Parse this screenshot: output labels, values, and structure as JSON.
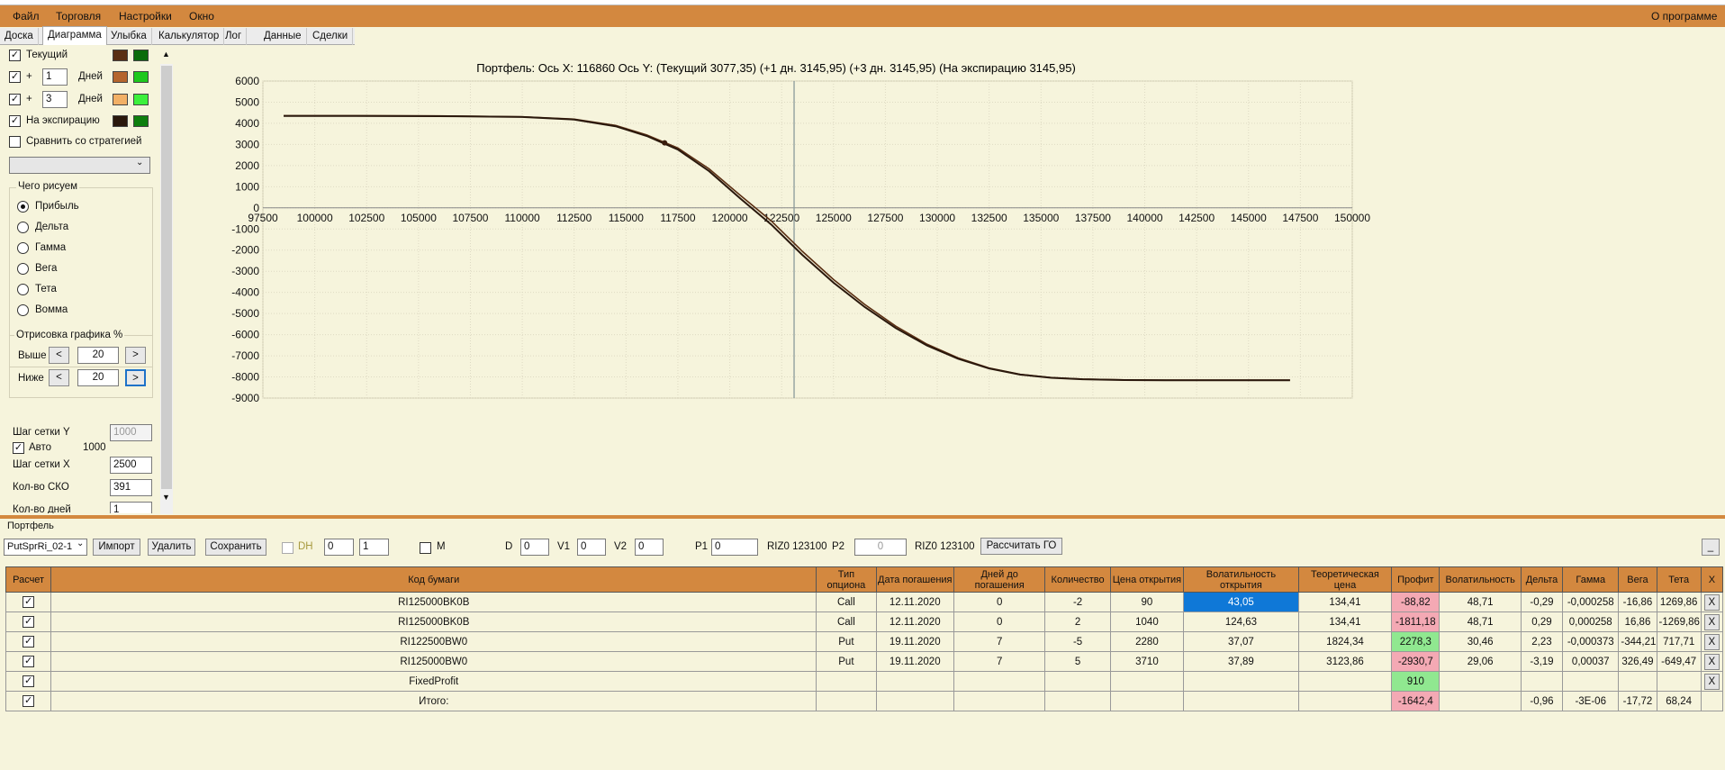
{
  "menu": {
    "file": "Файл",
    "trade": "Торговля",
    "settings": "Настройки",
    "window": "Окно",
    "about": "О программе"
  },
  "tabs": [
    "Доска",
    "Диаграмма",
    "Улыбка",
    "Калькулятор",
    "Лог",
    "Данные",
    "Сделки"
  ],
  "left": {
    "current_label": "Текущий",
    "plus1": "+",
    "days1": "1",
    "days_label": "Дней",
    "plus2": "+",
    "days2": "3",
    "expiry_label": "На экспирацию",
    "compare_label": "Сравнить со стратегией",
    "draw_group": "Чего рисуем",
    "radios": [
      "Прибыль",
      "Дельта",
      "Гамма",
      "Вега",
      "Тета",
      "Вомма"
    ],
    "plot_group": "Отрисовка графика %",
    "above_label": "Выше",
    "above_val": "20",
    "below_label": "Ниже",
    "below_val": "20",
    "lt": "<",
    "gt": ">",
    "grid_y_label": "Шаг сетки Y",
    "grid_y_val": "1000",
    "auto_label": "Авто",
    "auto_val": "1000",
    "grid_x_label": "Шаг сетки X",
    "grid_x_val": "2500",
    "sko_label": "Кол-во СКО",
    "sko_val": "391",
    "days_count_label": "Кол-во дней",
    "days_count_val": "1"
  },
  "colors": {
    "menu": "#d3883f",
    "current_a": "#5a2e12",
    "current_b": "#0b6b0b",
    "p1_a": "#b5652d",
    "p1_b": "#1ec81e",
    "p3_a": "#f2b066",
    "p3_b": "#3cf03c",
    "exp_a": "#2a180c",
    "exp_b": "#0e7f0e"
  },
  "chart_data": {
    "type": "line",
    "title": "Портфель: Ось X: 116860 Ось Y:  (Текущий 3077,35)  (+1 дн. 3145,95)  (+3 дн. 3145,95)  (На экспирацию 3145,95)",
    "xlim": [
      97500,
      150000
    ],
    "ylim": [
      -9000,
      6000
    ],
    "xticks": [
      "97500",
      "100000",
      "102500",
      "105000",
      "107500",
      "110000",
      "112500",
      "115000",
      "117500",
      "120000",
      "122500",
      "125000",
      "127500",
      "130000",
      "132500",
      "135000",
      "137500",
      "140000",
      "142500",
      "145000",
      "147500",
      "150000"
    ],
    "yticks": [
      "6000",
      "5000",
      "4000",
      "3000",
      "2000",
      "1000",
      "0",
      "-1000",
      "-2000",
      "-3000",
      "-4000",
      "-5000",
      "-6000",
      "-7000",
      "-8000",
      "-9000"
    ],
    "vline_x": 123100,
    "marker": {
      "x": 116860,
      "y": 3077.35
    },
    "series": [
      {
        "name": "Текущий",
        "x": [
          98500,
          102000,
          106000,
          110000,
          112500,
          114500,
          116000,
          117500,
          119000,
          120500,
          122000,
          123500,
          125000,
          126500,
          128000,
          129500,
          131000,
          132500,
          134000,
          135500,
          137000,
          139000,
          141000,
          143000,
          145000,
          146000,
          147000
        ],
        "y": [
          4360,
          4360,
          4350,
          4310,
          4200,
          3900,
          3450,
          2830,
          1850,
          600,
          -620,
          -2060,
          -3390,
          -4570,
          -5600,
          -6450,
          -7100,
          -7580,
          -7880,
          -8030,
          -8100,
          -8140,
          -8150,
          -8150,
          -8150,
          -8150,
          -8150
        ]
      },
      {
        "name": "На экспирацию",
        "x": [
          98500,
          102000,
          106000,
          110000,
          112500,
          114500,
          116000,
          117500,
          119000,
          120500,
          122000,
          123500,
          125000,
          126500,
          128000,
          129500,
          131000,
          132500,
          134000,
          135500,
          137000,
          139000,
          141000,
          143000,
          145000,
          146000,
          147000
        ],
        "y": [
          4350,
          4350,
          4340,
          4300,
          4180,
          3860,
          3400,
          2760,
          1740,
          450,
          -790,
          -2230,
          -3540,
          -4690,
          -5690,
          -6510,
          -7140,
          -7600,
          -7890,
          -8040,
          -8110,
          -8150,
          -8160,
          -8160,
          -8160,
          -8160,
          -8160
        ]
      }
    ],
    "grid": true
  },
  "portfolio": {
    "section_label": "Портфель",
    "strategy": "PutSprRi_02-1",
    "import": "Импорт",
    "delete": "Удалить",
    "save": "Сохранить",
    "dh": "DH",
    "spin1": "0",
    "spin2": "1",
    "m": "M",
    "d_label": "D",
    "d_val": "0",
    "v1_label": "V1",
    "v1_val": "0",
    "v2_label": "V2",
    "v2_val": "0",
    "p1_label": "P1",
    "p1_val": "0",
    "riz1": "RIZ0 123100",
    "p2_label": "P2",
    "p2_val": "0",
    "riz2": "RIZ0 123100",
    "calc_go": "Рассчитать ГО",
    "minimize": "_"
  },
  "table": {
    "headers": [
      "Расчет",
      "Код бумаги",
      "Тип опциона",
      "Дата погашения",
      "Дней до погашения",
      "Количество",
      "Цена открытия",
      "Волатильность открытия",
      "Теоретическая цена",
      "Профит",
      "Волатильность",
      "Дельта",
      "Гамма",
      "Вега",
      "Тета",
      "X"
    ],
    "rows": [
      [
        "✓",
        "RI125000BK0B",
        "Call",
        "12.11.2020",
        "0",
        "-2",
        "90",
        "43,05",
        "134,41",
        "-88,82",
        "48,71",
        "-0,29",
        "-0,000258",
        "-16,86",
        "1269,86",
        "X"
      ],
      [
        "✓",
        "RI125000BK0B",
        "Call",
        "12.11.2020",
        "0",
        "2",
        "1040",
        "124,63",
        "134,41",
        "-1811,18",
        "48,71",
        "0,29",
        "0,000258",
        "16,86",
        "-1269,86",
        "X"
      ],
      [
        "✓",
        "RI122500BW0",
        "Put",
        "19.11.2020",
        "7",
        "-5",
        "2280",
        "37,07",
        "1824,34",
        "2278,3",
        "30,46",
        "2,23",
        "-0,000373",
        "-344,21",
        "717,71",
        "X"
      ],
      [
        "✓",
        "RI125000BW0",
        "Put",
        "19.11.2020",
        "7",
        "5",
        "3710",
        "37,89",
        "3123,86",
        "-2930,7",
        "29,06",
        "-3,19",
        "0,00037",
        "326,49",
        "-649,47",
        "X"
      ],
      [
        "✓",
        "FixedProfit",
        "",
        "",
        "",
        "",
        "",
        "",
        "",
        "910",
        "",
        "",
        "",
        "",
        "",
        "X"
      ],
      [
        "✓",
        "Итого:",
        "",
        "",
        "",
        "",
        "",
        "",
        "",
        "-1642,4",
        "",
        "-0,96",
        "-3E-06",
        "-17,72",
        "68,24",
        ""
      ]
    ]
  }
}
